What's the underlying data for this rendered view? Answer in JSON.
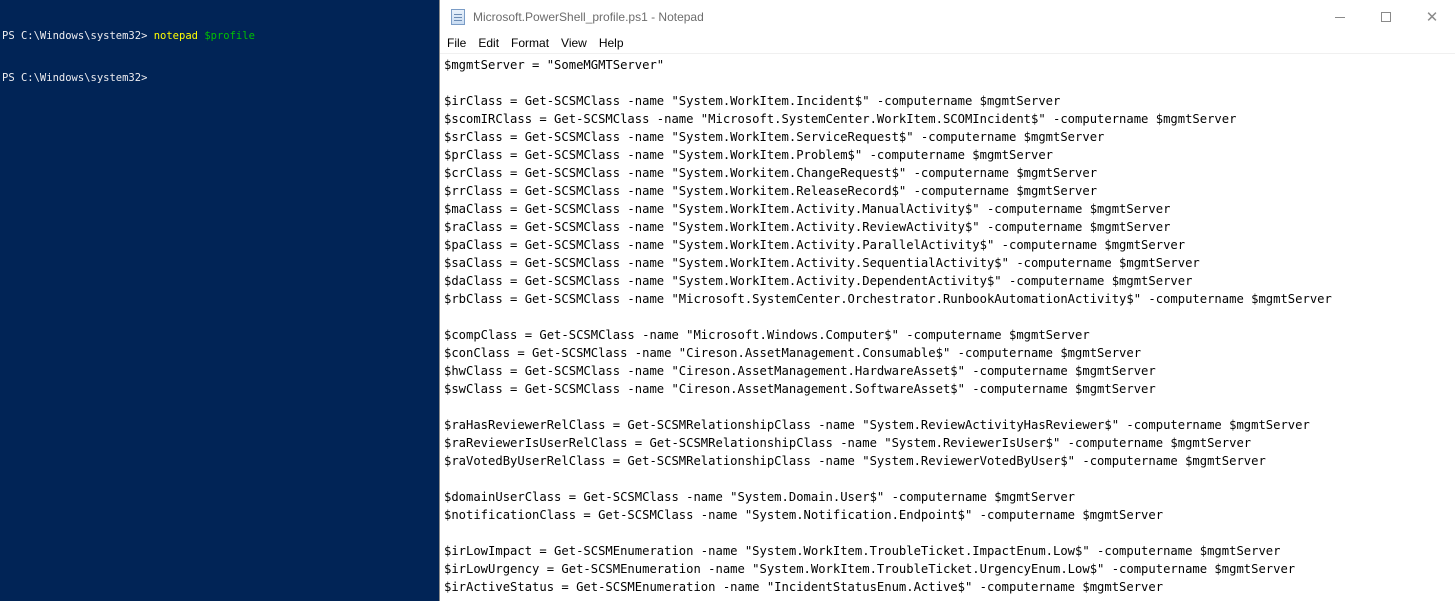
{
  "console": {
    "lines": [
      {
        "prompt": "PS C:\\Windows\\system32> ",
        "command": "notepad",
        "argument": "$profile"
      },
      {
        "prompt": "PS C:\\Windows\\system32> ",
        "command": "",
        "argument": ""
      }
    ],
    "colors": {
      "background": "#012456",
      "text": "#eeedf0",
      "command": "#ffff00",
      "variable": "#00c000"
    }
  },
  "notepad": {
    "title": "Microsoft.PowerShell_profile.ps1 - Notepad",
    "icon": "notepad-icon",
    "menu": [
      "File",
      "Edit",
      "Format",
      "View",
      "Help"
    ],
    "lines": [
      "$mgmtServer = \"SomeMGMTServer\"",
      "",
      "$irClass = Get-SCSMClass -name \"System.WorkItem.Incident$\" -computername $mgmtServer",
      "$scomIRClass = Get-SCSMClass -name \"Microsoft.SystemCenter.WorkItem.SCOMIncident$\" -computername $mgmtServer",
      "$srClass = Get-SCSMClass -name \"System.WorkItem.ServiceRequest$\" -computername $mgmtServer",
      "$prClass = Get-SCSMClass -name \"System.WorkItem.Problem$\" -computername $mgmtServer",
      "$crClass = Get-SCSMClass -name \"System.Workitem.ChangeRequest$\" -computername $mgmtServer",
      "$rrClass = Get-SCSMClass -name \"System.Workitem.ReleaseRecord$\" -computername $mgmtServer",
      "$maClass = Get-SCSMClass -name \"System.WorkItem.Activity.ManualActivity$\" -computername $mgmtServer",
      "$raClass = Get-SCSMClass -name \"System.WorkItem.Activity.ReviewActivity$\" -computername $mgmtServer",
      "$paClass = Get-SCSMClass -name \"System.WorkItem.Activity.ParallelActivity$\" -computername $mgmtServer",
      "$saClass = Get-SCSMClass -name \"System.WorkItem.Activity.SequentialActivity$\" -computername $mgmtServer",
      "$daClass = Get-SCSMClass -name \"System.WorkItem.Activity.DependentActivity$\" -computername $mgmtServer",
      "$rbClass = Get-SCSMClass -name \"Microsoft.SystemCenter.Orchestrator.RunbookAutomationActivity$\" -computername $mgmtServer",
      "",
      "$compClass = Get-SCSMClass -name \"Microsoft.Windows.Computer$\" -computername $mgmtServer",
      "$conClass = Get-SCSMClass -name \"Cireson.AssetManagement.Consumable$\" -computername $mgmtServer",
      "$hwClass = Get-SCSMClass -name \"Cireson.AssetManagement.HardwareAsset$\" -computername $mgmtServer",
      "$swClass = Get-SCSMClass -name \"Cireson.AssetManagement.SoftwareAsset$\" -computername $mgmtServer",
      "",
      "$raHasReviewerRelClass = Get-SCSMRelationshipClass -name \"System.ReviewActivityHasReviewer$\" -computername $mgmtServer",
      "$raReviewerIsUserRelClass = Get-SCSMRelationshipClass -name \"System.ReviewerIsUser$\" -computername $mgmtServer",
      "$raVotedByUserRelClass = Get-SCSMRelationshipClass -name \"System.ReviewerVotedByUser$\" -computername $mgmtServer",
      "",
      "$domainUserClass = Get-SCSMClass -name \"System.Domain.User$\" -computername $mgmtServer",
      "$notificationClass = Get-SCSMClass -name \"System.Notification.Endpoint$\" -computername $mgmtServer",
      "",
      "$irLowImpact = Get-SCSMEnumeration -name \"System.WorkItem.TroubleTicket.ImpactEnum.Low$\" -computername $mgmtServer",
      "$irLowUrgency = Get-SCSMEnumeration -name \"System.WorkItem.TroubleTicket.UrgencyEnum.Low$\" -computername $mgmtServer",
      "$irActiveStatus = Get-SCSMEnumeration -name \"IncidentStatusEnum.Active$\" -computername $mgmtServer"
    ]
  }
}
